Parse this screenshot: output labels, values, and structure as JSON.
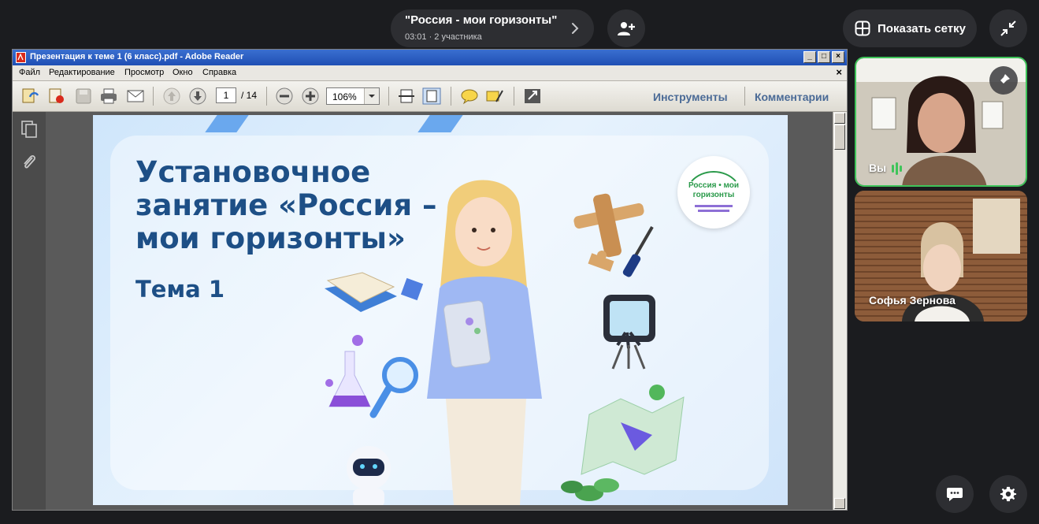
{
  "call": {
    "title": "\"Россия - мои горизонты\"",
    "subtitle": "03:01 · 2 участника",
    "grid_button_label": "Показать сетку"
  },
  "reader": {
    "window_title": "Презентация к теме 1 (6 класс).pdf - Adobe Reader",
    "menu": [
      "Файл",
      "Редактирование",
      "Просмотр",
      "Окно",
      "Справка"
    ],
    "page_current": "1",
    "page_total": "/ 14",
    "zoom": "106%",
    "tools_label": "Инструменты",
    "comments_label": "Комментарии"
  },
  "slide": {
    "title": "Установочное занятие «Россия – мои горизонты»",
    "subtitle": "Тема 1",
    "logo_line1": "Россия • мои",
    "logo_line2": "горизонты"
  },
  "participants": [
    {
      "name": "Вы"
    },
    {
      "name": "Софья Зернова"
    }
  ],
  "colors": {
    "background": "#1b1c1f",
    "pill": "#2d2e32",
    "speaking_border": "#3fc45a",
    "slide_title": "#1d4f86"
  },
  "icons": [
    "chevron-right-icon",
    "add-user-icon",
    "grid-icon",
    "collapse-icon",
    "pin-icon",
    "mic-active-icon",
    "chat-icon",
    "settings-icon"
  ]
}
